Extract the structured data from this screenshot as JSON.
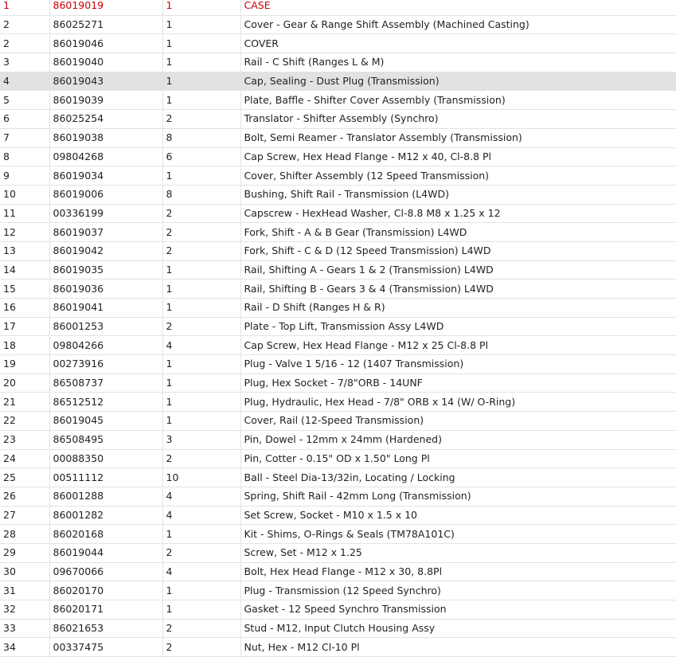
{
  "parts_table": {
    "rows": [
      {
        "ref": "1",
        "part": "86019019",
        "qty": "1",
        "desc": "CASE"
      },
      {
        "ref": "2",
        "part": "86025271",
        "qty": "1",
        "desc": "Cover - Gear & Range Shift Assembly (Machined Casting)"
      },
      {
        "ref": "2",
        "part": "86019046",
        "qty": "1",
        "desc": "COVER"
      },
      {
        "ref": "3",
        "part": "86019040",
        "qty": "1",
        "desc": "Rail - C Shift (Ranges L & M)"
      },
      {
        "ref": "4",
        "part": "86019043",
        "qty": "1",
        "desc": "Cap, Sealing - Dust Plug (Transmission)"
      },
      {
        "ref": "5",
        "part": "86019039",
        "qty": "1",
        "desc": "Plate, Baffle - Shifter Cover Assembly (Transmission)"
      },
      {
        "ref": "6",
        "part": "86025254",
        "qty": "2",
        "desc": "Translator - Shifter Assembly (Synchro)"
      },
      {
        "ref": "7",
        "part": "86019038",
        "qty": "8",
        "desc": "Bolt, Semi Reamer - Translator Assembly (Transmission)"
      },
      {
        "ref": "8",
        "part": "09804268",
        "qty": "6",
        "desc": "Cap Screw, Hex Head Flange - M12 x 40, Cl-8.8 Pl"
      },
      {
        "ref": "9",
        "part": "86019034",
        "qty": "1",
        "desc": "Cover, Shifter Assembly (12 Speed Transmission)"
      },
      {
        "ref": "10",
        "part": "86019006",
        "qty": "8",
        "desc": "Bushing, Shift Rail - Transmission (L4WD)"
      },
      {
        "ref": "11",
        "part": "00336199",
        "qty": "2",
        "desc": "Capscrew - HexHead Washer, Cl-8.8 M8 x 1.25 x 12"
      },
      {
        "ref": "12",
        "part": "86019037",
        "qty": "2",
        "desc": "Fork, Shift - A & B Gear (Transmission) L4WD"
      },
      {
        "ref": "13",
        "part": "86019042",
        "qty": "2",
        "desc": "Fork, Shift - C & D (12 Speed Transmission) L4WD"
      },
      {
        "ref": "14",
        "part": "86019035",
        "qty": "1",
        "desc": "Rail, Shifting A - Gears 1 & 2 (Transmission) L4WD"
      },
      {
        "ref": "15",
        "part": "86019036",
        "qty": "1",
        "desc": "Rail, Shifting B - Gears 3 & 4 (Transmission) L4WD"
      },
      {
        "ref": "16",
        "part": "86019041",
        "qty": "1",
        "desc": "Rail - D Shift (Ranges H & R)"
      },
      {
        "ref": "17",
        "part": "86001253",
        "qty": "2",
        "desc": "Plate - Top Lift, Transmission Assy L4WD"
      },
      {
        "ref": "18",
        "part": "09804266",
        "qty": "4",
        "desc": "Cap Screw, Hex Head Flange - M12 x 25 Cl-8.8 Pl"
      },
      {
        "ref": "19",
        "part": "00273916",
        "qty": "1",
        "desc": "Plug - Valve 1 5/16 - 12 (1407 Transmission)"
      },
      {
        "ref": "20",
        "part": "86508737",
        "qty": "1",
        "desc": "Plug, Hex Socket - 7/8\"ORB - 14UNF"
      },
      {
        "ref": "21",
        "part": "86512512",
        "qty": "1",
        "desc": "Plug, Hydraulic, Hex Head - 7/8\" ORB x 14 (W/ O-Ring)"
      },
      {
        "ref": "22",
        "part": "86019045",
        "qty": "1",
        "desc": "Cover, Rail (12-Speed Transmission)"
      },
      {
        "ref": "23",
        "part": "86508495",
        "qty": "3",
        "desc": "Pin, Dowel - 12mm x 24mm (Hardened)"
      },
      {
        "ref": "24",
        "part": "00088350",
        "qty": "2",
        "desc": "Pin, Cotter - 0.15\" OD x 1.50\" Long Pl"
      },
      {
        "ref": "25",
        "part": "00511112",
        "qty": "10",
        "desc": "Ball - Steel Dia-13/32in, Locating / Locking"
      },
      {
        "ref": "26",
        "part": "86001288",
        "qty": "4",
        "desc": "Spring, Shift Rail - 42mm Long (Transmission)"
      },
      {
        "ref": "27",
        "part": "86001282",
        "qty": "4",
        "desc": "Set Screw, Socket - M10 x 1.5 x 10"
      },
      {
        "ref": "28",
        "part": "86020168",
        "qty": "1",
        "desc": "Kit - Shims, O-Rings & Seals (TM78A101C)"
      },
      {
        "ref": "29",
        "part": "86019044",
        "qty": "2",
        "desc": "Screw, Set - M12 x 1.25"
      },
      {
        "ref": "30",
        "part": "09670066",
        "qty": "4",
        "desc": "Bolt, Hex Head Flange - M12 x 30, 8.8Pl"
      },
      {
        "ref": "31",
        "part": "86020170",
        "qty": "1",
        "desc": "Plug - Transmission (12 Speed Synchro)"
      },
      {
        "ref": "32",
        "part": "86020171",
        "qty": "1",
        "desc": "Gasket - 12 Speed Synchro Transmission"
      },
      {
        "ref": "33",
        "part": "86021653",
        "qty": "2",
        "desc": "Stud - M12, Input Clutch Housing Assy"
      },
      {
        "ref": "34",
        "part": "00337475",
        "qty": "2",
        "desc": "Nut, Hex - M12 Cl-10 Pl"
      }
    ]
  },
  "colors": {
    "selected_text": "#cc0000",
    "hover_row_bg": "#e2e2e2",
    "grid_line": "#e3e3e3"
  }
}
